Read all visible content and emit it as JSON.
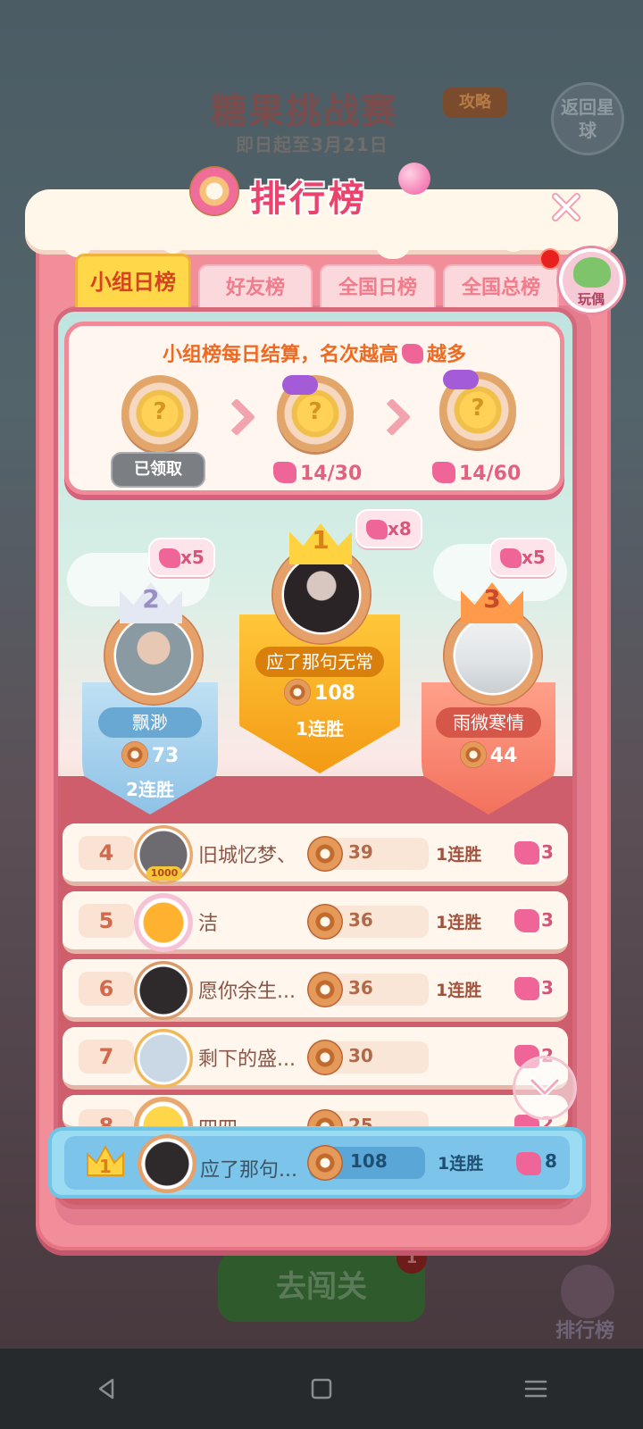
{
  "background": {
    "event_title": "糖果挑战赛",
    "event_date": "即日起至3月21日",
    "guide_label": "攻略",
    "return_label": "返回星球",
    "go_label": "去闯关",
    "go_badge": "1",
    "rank_label": "排行榜"
  },
  "panel": {
    "title": "排行榜",
    "toy_label": "玩偶"
  },
  "tabs": [
    {
      "label": "小组日榜",
      "active": true
    },
    {
      "label": "好友榜",
      "active": false
    },
    {
      "label": "全国日榜",
      "active": false
    },
    {
      "label": "全国总榜",
      "active": false
    }
  ],
  "reward": {
    "title_part1": "小组榜每日结算，名次越高",
    "title_part2": "越多",
    "claimed_label": "已领取",
    "progress_1": "14/30",
    "progress_2": "14/60"
  },
  "podium": {
    "first": {
      "rank": "1",
      "name": "应了那句无常",
      "score": "108",
      "streak": "1连胜",
      "bonus": "x8"
    },
    "second": {
      "rank": "2",
      "name": "飘渺",
      "score": "73",
      "streak": "2连胜",
      "bonus": "x5"
    },
    "third": {
      "rank": "3",
      "name": "雨微寒情",
      "score": "44",
      "bonus": "x5"
    }
  },
  "list": [
    {
      "rank": "4",
      "name": "旧城忆梦、",
      "score": "39",
      "streak": "1连胜",
      "pieces": "3"
    },
    {
      "rank": "5",
      "name": "洁",
      "score": "36",
      "streak": "1连胜",
      "pieces": "3"
    },
    {
      "rank": "6",
      "name": "愿你余生...",
      "score": "36",
      "streak": "1连胜",
      "pieces": "3"
    },
    {
      "rank": "7",
      "name": "剩下的盛...",
      "score": "30",
      "streak": "",
      "pieces": "2"
    },
    {
      "rank": "8",
      "name": "四四",
      "score": "25",
      "streak": "",
      "pieces": "2"
    }
  ],
  "me": {
    "rank": "1",
    "name": "应了那句...",
    "score": "108",
    "streak": "1连胜",
    "pieces": "8"
  },
  "avatar_badge": "1000",
  "colors": {
    "panel_pink": "#f28e9a",
    "tab_active": "#ffd84a",
    "gold_podium": "#f7a51c",
    "silver_podium": "#9ccbe8",
    "bronze_podium": "#f4846a",
    "my_row": "#9bdcf2"
  },
  "icons": [
    "close-icon",
    "donut-icon",
    "puzzle-piece-icon",
    "crown-icon",
    "chevron-down-icon",
    "back-icon",
    "home-icon",
    "menu-icon"
  ]
}
